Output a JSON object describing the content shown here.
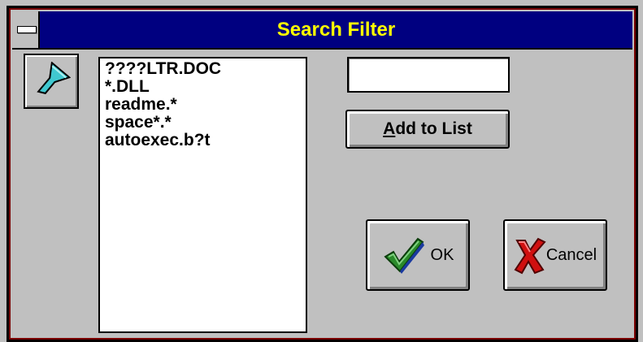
{
  "window": {
    "title": "Search Filter",
    "system_menu_icon": "system-menu-icon"
  },
  "filter_icon": "search-filter-icon",
  "filter_list": {
    "items": [
      "????LTR.DOC",
      "*.DLL",
      "readme.*",
      "space*.*",
      "autoexec.b?t"
    ]
  },
  "filter_input": {
    "value": "",
    "placeholder": ""
  },
  "buttons": {
    "add_to_list": {
      "accelerator": "A",
      "rest": "dd to List"
    },
    "ok": {
      "label": "OK",
      "icon": "checkmark-icon"
    },
    "cancel": {
      "label": "Cancel",
      "icon": "x-icon"
    }
  },
  "colors": {
    "titlebar": "#000080",
    "title_text": "#ffff00",
    "face": "#c0c0c0",
    "check": "#1e7a1e",
    "cross": "#c00000"
  }
}
